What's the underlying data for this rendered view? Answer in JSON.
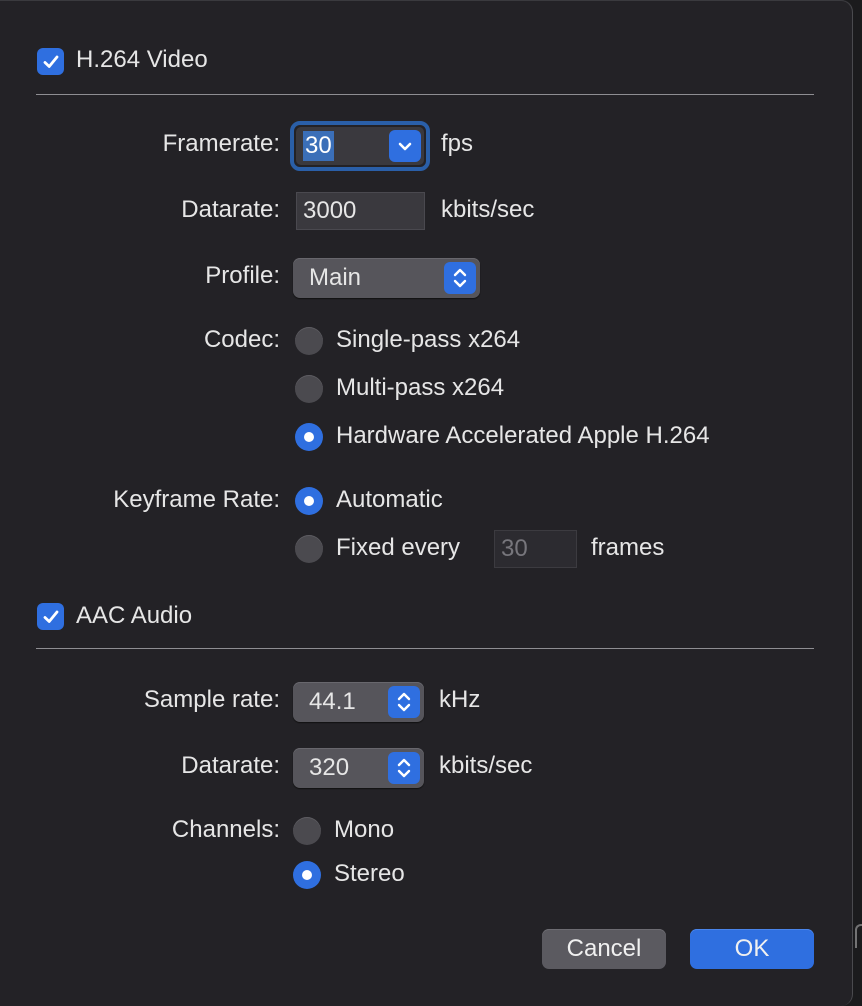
{
  "video": {
    "enable_label": "H.264 Video",
    "enabled": true,
    "framerate": {
      "label": "Framerate:",
      "value": "30",
      "unit": "fps"
    },
    "datarate": {
      "label": "Datarate:",
      "value": "3000",
      "unit": "kbits/sec"
    },
    "profile": {
      "label": "Profile:",
      "value": "Main"
    },
    "codec": {
      "label": "Codec:",
      "options": [
        "Single-pass x264",
        "Multi-pass x264",
        "Hardware Accelerated Apple H.264"
      ],
      "selected": "Hardware Accelerated Apple H.264"
    },
    "keyframe": {
      "label": "Keyframe Rate:",
      "automatic_label": "Automatic",
      "fixed_label": "Fixed every",
      "fixed_value": "30",
      "fixed_unit": "frames",
      "selected": "Automatic"
    }
  },
  "audio": {
    "enable_label": "AAC Audio",
    "enabled": true,
    "sample_rate": {
      "label": "Sample rate:",
      "value": "44.1",
      "unit": "kHz"
    },
    "datarate": {
      "label": "Datarate:",
      "value": "320",
      "unit": "kbits/sec"
    },
    "channels": {
      "label": "Channels:",
      "options": [
        "Mono",
        "Stereo"
      ],
      "selected": "Stereo"
    }
  },
  "buttons": {
    "cancel": "Cancel",
    "ok": "OK"
  },
  "colors": {
    "accent": "#2f6fe0",
    "background": "#232226"
  },
  "icons": {
    "checkmark": "checkmark-icon",
    "chevron_down": "chevron-down-icon",
    "up_down": "up-down-chevron-icon"
  }
}
